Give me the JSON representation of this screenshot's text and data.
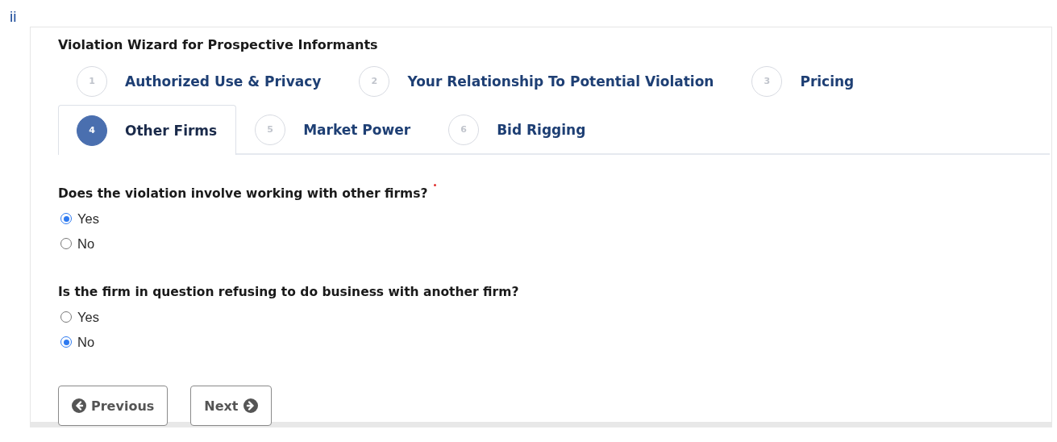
{
  "page_marker": "ii",
  "wizard": {
    "title": "Violation Wizard for Prospective Informants",
    "steps": [
      {
        "number": "1",
        "label": "Authorized Use & Privacy",
        "selected": false
      },
      {
        "number": "2",
        "label": "Your Relationship To Potential Violation",
        "selected": false
      },
      {
        "number": "3",
        "label": "Pricing",
        "selected": false
      },
      {
        "number": "4",
        "label": "Other Firms",
        "selected": true
      },
      {
        "number": "5",
        "label": "Market Power",
        "selected": false
      },
      {
        "number": "6",
        "label": "Bid Rigging",
        "selected": false
      }
    ],
    "questions": [
      {
        "text": "Does the violation involve working with other firms?",
        "required": true,
        "options": [
          {
            "label": "Yes",
            "selected": true
          },
          {
            "label": "No",
            "selected": false
          }
        ]
      },
      {
        "text": "Is the firm in question refusing to do business with another firm?",
        "required": false,
        "options": [
          {
            "label": "Yes",
            "selected": false
          },
          {
            "label": "No",
            "selected": true
          }
        ]
      }
    ],
    "buttons": [
      {
        "label": "Previous",
        "kind": "previous"
      },
      {
        "label": "Next",
        "kind": "next"
      }
    ]
  }
}
